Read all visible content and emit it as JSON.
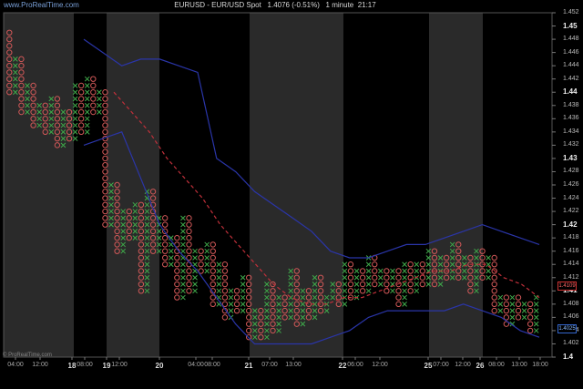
{
  "header": {
    "watermark": "www.ProRealTime.com",
    "title": "EURUSD - EUR/USD Spot   1.4076 (-0.51%)   1 minute  21:17"
  },
  "footer": {
    "copyright": "© ProRealTime.com"
  },
  "colors": {
    "background": "#000000",
    "session_band": "#2a2a2a",
    "x_symbol": "#3fa84a",
    "o_symbol": "#d15858",
    "bollinger": "#2a35a8",
    "moving_average": "#c0303a"
  },
  "price_flags": {
    "current_red": "1.4109",
    "current_blue": "1.4025"
  },
  "chart_data": {
    "type": "point-and-figure",
    "title": "EURUSD - EUR/USD Spot   1.4076 (-0.51%)   1 minute  21:17",
    "y_axis": {
      "min": 1.4,
      "max": 1.452,
      "side": "right",
      "ticks": [
        "1.452",
        "1.45",
        "1.448",
        "1.446",
        "1.444",
        "1.442",
        "1.44",
        "1.438",
        "1.436",
        "1.434",
        "1.432",
        "1.43",
        "1.428",
        "1.426",
        "1.424",
        "1.422",
        "1.42",
        "1.418",
        "1.416",
        "1.414",
        "1.412",
        "1.41",
        "1.408",
        "1.406",
        "1.404",
        "1.402",
        "1.4"
      ],
      "major_ticks": [
        "1.45",
        "1.44",
        "1.43",
        "1.42",
        "1.41",
        "1.4"
      ]
    },
    "x_axis": {
      "ticks": [
        {
          "label": "04:00",
          "day": false
        },
        {
          "label": "12:00",
          "day": false
        },
        {
          "label": "18",
          "day": true
        },
        {
          "label": "08:00",
          "day": false
        },
        {
          "label": "19",
          "day": true
        },
        {
          "label": "12:00",
          "day": false
        },
        {
          "label": "20",
          "day": true
        },
        {
          "label": "04:00",
          "day": false
        },
        {
          "label": "08:00",
          "day": false
        },
        {
          "label": "21",
          "day": true
        },
        {
          "label": "07:00",
          "day": false
        },
        {
          "label": "13:00",
          "day": false
        },
        {
          "label": "22",
          "day": true
        },
        {
          "label": "06:00",
          "day": false
        },
        {
          "label": "12:00",
          "day": false
        },
        {
          "label": "25",
          "day": true
        },
        {
          "label": "07:00",
          "day": false
        },
        {
          "label": "12:00",
          "day": false
        },
        {
          "label": "26",
          "day": true
        },
        {
          "label": "08:00",
          "day": false
        },
        {
          "label": "13:00",
          "day": false
        },
        {
          "label": "18:00",
          "day": false
        }
      ]
    },
    "session_bands": 5,
    "pnf_path": [
      1.449,
      1.44,
      1.445,
      1.437,
      1.441,
      1.435,
      1.438,
      1.434,
      1.439,
      1.432,
      1.437,
      1.433,
      1.441,
      1.434,
      1.442,
      1.437,
      1.44,
      1.42,
      1.426,
      1.416,
      1.422,
      1.418,
      1.423,
      1.41,
      1.425,
      1.416,
      1.421,
      1.414,
      1.418,
      1.409,
      1.421,
      1.41,
      1.416,
      1.413,
      1.417,
      1.408,
      1.414,
      1.406,
      1.41,
      1.407,
      1.412,
      1.403,
      1.407,
      1.403,
      1.411,
      1.404,
      1.409,
      1.406,
      1.413,
      1.405,
      1.41,
      1.406,
      1.412,
      1.407,
      1.409,
      1.411,
      1.408,
      1.414,
      1.409,
      1.413,
      1.41,
      1.415,
      1.411,
      1.413,
      1.41,
      1.413,
      1.408,
      1.414,
      1.41,
      1.414,
      1.411,
      1.416,
      1.411,
      1.415,
      1.412,
      1.417,
      1.412,
      1.415,
      1.41,
      1.416,
      1.412,
      1.415,
      1.407,
      1.409,
      1.405,
      1.409,
      1.406,
      1.408,
      1.404,
      1.409
    ],
    "bollinger_upper": [
      1.448,
      1.446,
      1.444,
      1.445,
      1.445,
      1.444,
      1.443,
      1.43,
      1.428,
      1.425,
      1.423,
      1.421,
      1.419,
      1.416,
      1.415,
      1.415,
      1.416,
      1.417,
      1.417,
      1.418,
      1.419,
      1.42,
      1.419,
      1.418,
      1.417
    ],
    "bollinger_lower": [
      1.432,
      1.433,
      1.434,
      1.427,
      1.42,
      1.416,
      1.413,
      1.409,
      1.405,
      1.402,
      1.402,
      1.402,
      1.402,
      1.403,
      1.404,
      1.406,
      1.407,
      1.407,
      1.407,
      1.407,
      1.408,
      1.407,
      1.406,
      1.404,
      1.403
    ],
    "moving_average": [
      1.44,
      1.437,
      1.434,
      1.43,
      1.427,
      1.424,
      1.42,
      1.417,
      1.414,
      1.411,
      1.409,
      1.408,
      1.408,
      1.409,
      1.409,
      1.41,
      1.411,
      1.412,
      1.413,
      1.413,
      1.414,
      1.414,
      1.412,
      1.411,
      1.409
    ]
  }
}
